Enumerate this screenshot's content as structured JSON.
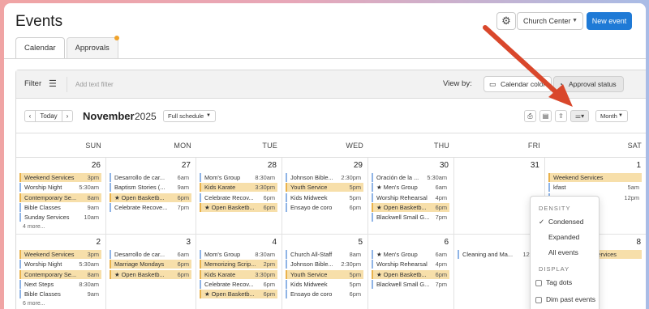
{
  "header": {
    "title": "Events",
    "org_select": "Church Center",
    "new_event": "New event"
  },
  "tabs": [
    {
      "label": "Calendar",
      "active": true
    },
    {
      "label": "Approvals",
      "active": false,
      "badge": true
    }
  ],
  "filterbar": {
    "filter_label": "Filter",
    "add_filter_placeholder": "Add text filter",
    "view_by": "View by:",
    "calendar_color": "Calendar color",
    "approval_status": "Approval status"
  },
  "nav": {
    "today": "Today",
    "month": "November",
    "year": "2025",
    "schedule": "Full schedule",
    "view": "Month"
  },
  "days_of_week": [
    "SUN",
    "MON",
    "TUE",
    "WED",
    "THU",
    "FRI",
    "SAT"
  ],
  "weeks": [
    {
      "days": [
        {
          "num": "26",
          "events": [
            {
              "name": "Weekend Services",
              "time": "3pm",
              "hl": true
            },
            {
              "name": "Worship Night",
              "time": "5:30am"
            },
            {
              "name": "Contemporary Se...",
              "time": "8am",
              "hl": true
            },
            {
              "name": "Bible Classes",
              "time": "9am"
            },
            {
              "name": "Sunday Services",
              "time": "10am"
            }
          ],
          "more": "4 more..."
        },
        {
          "num": "27",
          "events": [
            {
              "name": "Desarrollo de car...",
              "time": "6am"
            },
            {
              "name": "Baptism Stories (...",
              "time": "9am"
            },
            {
              "name": "★ Open Basketb...",
              "time": "6pm",
              "hl": true
            },
            {
              "name": "Celebrate Recove...",
              "time": "7pm"
            }
          ]
        },
        {
          "num": "28",
          "events": [
            {
              "name": "Mom's Group",
              "time": "8:30am"
            },
            {
              "name": "Kids Karate",
              "time": "3:30pm",
              "hl": true
            },
            {
              "name": "Celebrate Recov...",
              "time": "6pm"
            },
            {
              "name": "★ Open Basketb...",
              "time": "6pm",
              "hl": true
            }
          ]
        },
        {
          "num": "29",
          "events": [
            {
              "name": "Johnson Bible...",
              "time": "2:30pm"
            },
            {
              "name": "Youth Service",
              "time": "5pm",
              "hl": true
            },
            {
              "name": "Kids Midweek",
              "time": "5pm"
            },
            {
              "name": "Ensayo de coro",
              "time": "6pm"
            }
          ]
        },
        {
          "num": "30",
          "events": [
            {
              "name": "Oración de la ...",
              "time": "5:30am"
            },
            {
              "name": "★ Men's Group",
              "time": "6am"
            },
            {
              "name": "Worship Rehearsal",
              "time": "4pm"
            },
            {
              "name": "★ Open Basketb...",
              "time": "6pm",
              "hl": true
            },
            {
              "name": "Blackwell Small G...",
              "time": "7pm"
            }
          ]
        },
        {
          "num": "31",
          "events": []
        },
        {
          "num": "1",
          "events": [
            {
              "name": "Weekend Services",
              "time": "",
              "hl": true
            },
            {
              "name": "kfast",
              "time": "5am"
            },
            {
              "name": "eat",
              "time": "12pm"
            }
          ]
        }
      ]
    },
    {
      "days": [
        {
          "num": "2",
          "events": [
            {
              "name": "Weekend Services",
              "time": "3pm",
              "hl": true
            },
            {
              "name": "Worship Night",
              "time": "5:30am"
            },
            {
              "name": "Contemporary Se...",
              "time": "8am",
              "hl": true
            },
            {
              "name": "Next Steps",
              "time": "8:30am"
            },
            {
              "name": "Bible Classes",
              "time": "9am"
            }
          ],
          "more": "6 more..."
        },
        {
          "num": "3",
          "events": [
            {
              "name": "Desarrollo de car...",
              "time": "6am"
            },
            {
              "name": "Marriage Mondays",
              "time": "6pm",
              "hl": true
            },
            {
              "name": "★ Open Basketb...",
              "time": "6pm",
              "hl": true
            }
          ]
        },
        {
          "num": "4",
          "events": [
            {
              "name": "Mom's Group",
              "time": "8:30am"
            },
            {
              "name": "Memorizing Scrip...",
              "time": "2pm",
              "hl": true
            },
            {
              "name": "Kids Karate",
              "time": "3:30pm",
              "hl": true
            },
            {
              "name": "Celebrate Recov...",
              "time": "6pm"
            },
            {
              "name": "★ Open Basketb...",
              "time": "6pm",
              "hl": true
            }
          ]
        },
        {
          "num": "5",
          "events": [
            {
              "name": "Church All-Staff",
              "time": "8am"
            },
            {
              "name": "Johnson Bible...",
              "time": "2:30pm"
            },
            {
              "name": "Youth Service",
              "time": "5pm",
              "hl": true
            },
            {
              "name": "Kids Midweek",
              "time": "5pm"
            },
            {
              "name": "Ensayo de coro",
              "time": "6pm"
            }
          ]
        },
        {
          "num": "6",
          "events": [
            {
              "name": "★ Men's Group",
              "time": "6am"
            },
            {
              "name": "Worship Rehearsal",
              "time": "4pm"
            },
            {
              "name": "★ Open Basketb...",
              "time": "6pm",
              "hl": true
            },
            {
              "name": "Blackwell Small G...",
              "time": "7pm"
            }
          ]
        },
        {
          "num": "7",
          "events": [
            {
              "name": "Cleaning and Ma...",
              "time": "12pm"
            }
          ]
        },
        {
          "num": "8",
          "events": [
            {
              "name": "6pm Weekend Services",
              "time": "",
              "hl": true
            }
          ]
        }
      ]
    }
  ],
  "density_menu": {
    "density_heading": "DENSITY",
    "condensed": "Condensed",
    "expanded": "Expanded",
    "all_events": "All events",
    "display_heading": "DISPLAY",
    "tag_dots": "Tag dots",
    "dim_past": "Dim past events"
  },
  "colors": {
    "accent": "#1f7ad6",
    "highlight": "#f7dfaa",
    "annotation_arrow": "#d9472b"
  }
}
